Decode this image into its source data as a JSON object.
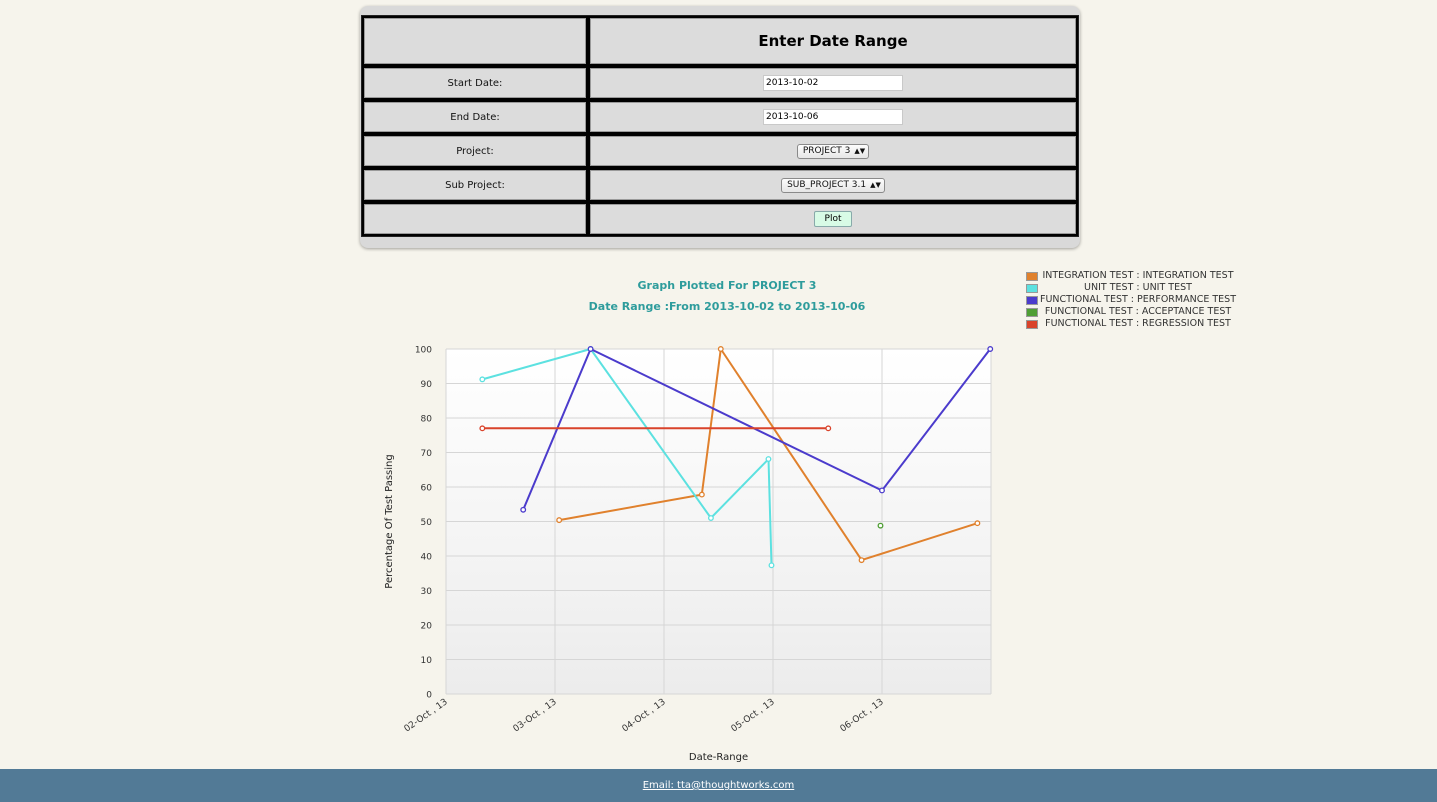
{
  "form": {
    "title": "Enter Date Range",
    "start_label": "Start Date:",
    "start_value": "2013-10-02",
    "end_label": "End Date:",
    "end_value": "2013-10-06",
    "project_label": "Project:",
    "project_value": "PROJECT 3",
    "subproject_label": "Sub Project:",
    "subproject_value": "SUB_PROJECT 3.1",
    "plot_label": "Plot"
  },
  "chart_data": {
    "type": "line",
    "title": "Graph Plotted For PROJECT 3",
    "subtitle": "Date Range :From 2013-10-02 to 2013-10-06",
    "xlabel": "Date-Range",
    "ylabel": "Percentage Of Test Passing",
    "ylim": [
      0,
      100
    ],
    "xlim": [
      "2013-10-02T00:00",
      "2013-10-07T00:00"
    ],
    "yticks": [
      0,
      10,
      20,
      30,
      40,
      50,
      60,
      70,
      80,
      90,
      100
    ],
    "xticks": [
      "02-Oct , 13",
      "03-Oct , 13",
      "04-Oct , 13",
      "05-Oct , 13",
      "06-Oct , 13"
    ],
    "grid": true,
    "legend_position": "top-right",
    "series": [
      {
        "name": "INTEGRATION TEST : INTEGRATION TEST",
        "color": "#e0812d",
        "points": [
          [
            "2013-10-03T00:55",
            50.4
          ],
          [
            "2013-10-04T08:20",
            57.8
          ],
          [
            "2013-10-04T12:30",
            100
          ],
          [
            "2013-10-05T19:30",
            38.8
          ],
          [
            "2013-10-06T21:00",
            49.5
          ]
        ]
      },
      {
        "name": "UNIT TEST : UNIT TEST",
        "color": "#5ce1e0",
        "points": [
          [
            "2013-10-02T08:00",
            91.2
          ],
          [
            "2013-10-03T07:50",
            100
          ],
          [
            "2013-10-04T10:20",
            51
          ],
          [
            "2013-10-04T23:00",
            68.1
          ],
          [
            "2013-10-04T23:40",
            37.3
          ]
        ]
      },
      {
        "name": "FUNCTIONAL TEST : PERFORMANCE TEST",
        "color": "#4b3bcc",
        "points": [
          [
            "2013-10-02T17:00",
            53.4
          ],
          [
            "2013-10-03T07:50",
            100
          ],
          [
            "2013-10-06T00:00",
            59
          ],
          [
            "2013-10-06T23:50",
            100
          ]
        ]
      },
      {
        "name": "FUNCTIONAL TEST : ACCEPTANCE TEST",
        "color": "#4f9e34",
        "points": [
          [
            "2013-10-05T23:40",
            48.8
          ]
        ]
      },
      {
        "name": "FUNCTIONAL TEST : REGRESSION TEST",
        "color": "#d9432b",
        "points": [
          [
            "2013-10-02T08:00",
            77
          ],
          [
            "2013-10-05T12:10",
            77
          ]
        ]
      }
    ]
  },
  "footer": {
    "email_text": "Email: tta@thoughtworks.com"
  }
}
